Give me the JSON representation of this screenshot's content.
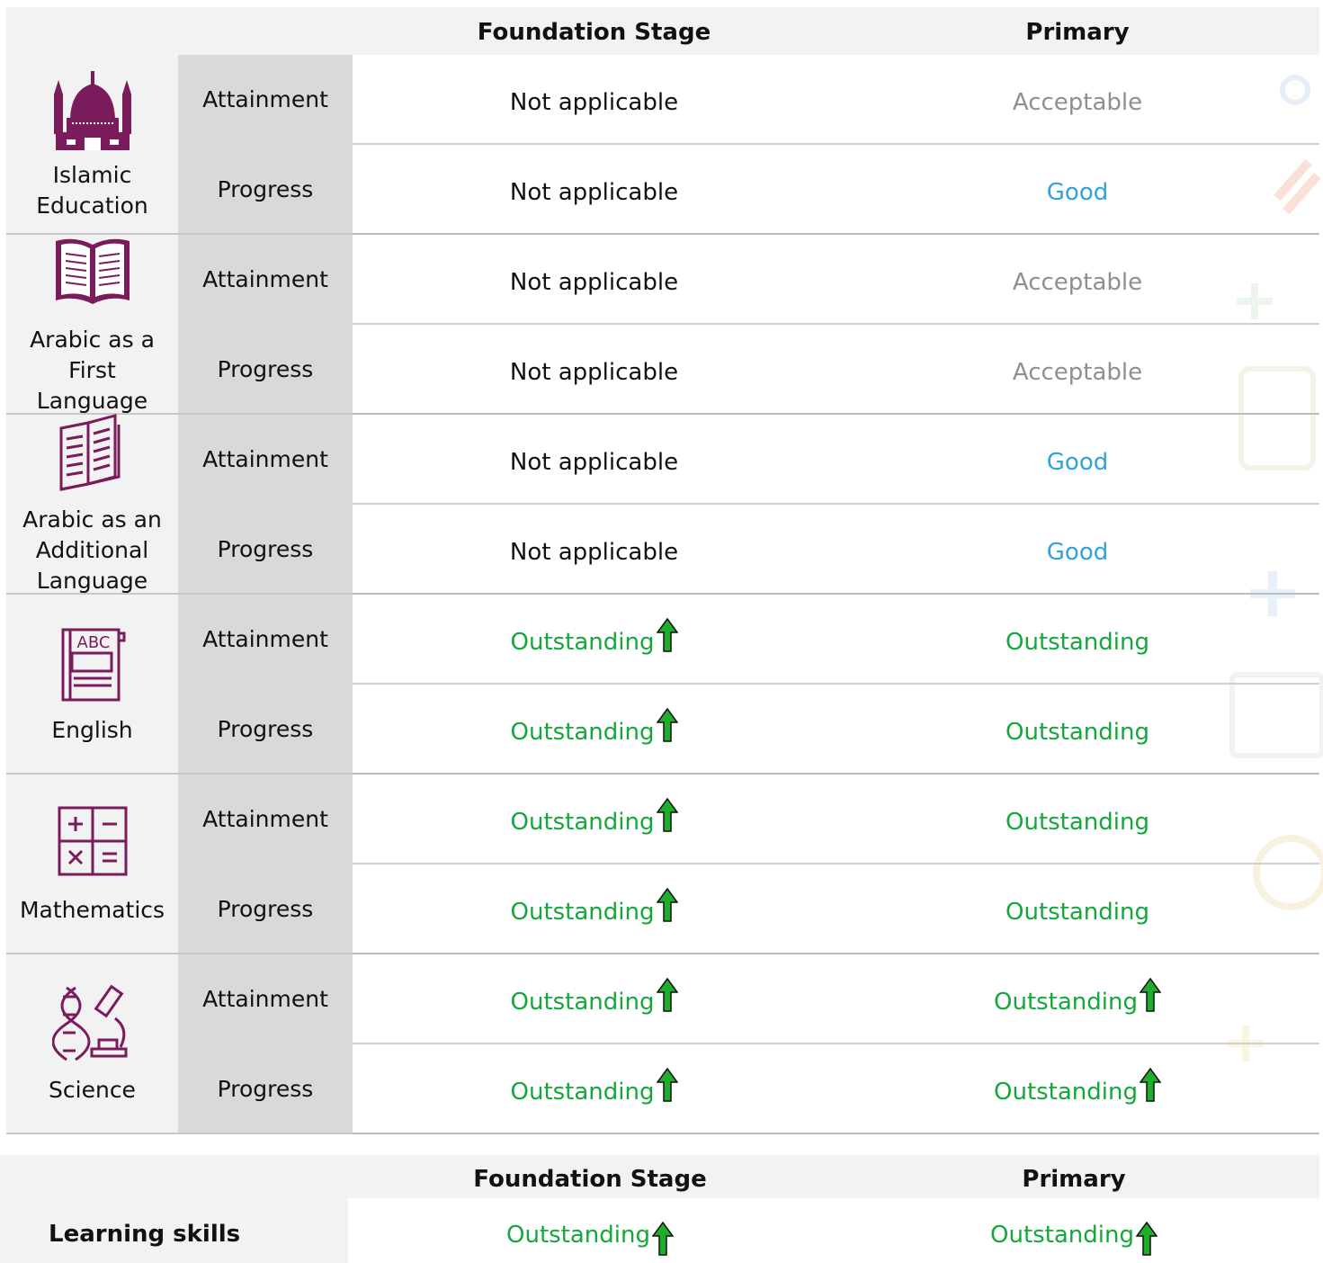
{
  "header": {
    "foundation_label": "Foundation Stage",
    "primary_label": "Primary"
  },
  "colors": {
    "icon_purple": "#7a1c5c",
    "not_applicable": "#111111",
    "acceptable": "#8f8f8f",
    "good": "#2ea3dc",
    "outstanding": "#14a83b",
    "arrow_green": "#1fae2c"
  },
  "subjects": [
    {
      "name": "Islamic\nEducation",
      "icon": "mosque-icon",
      "rows": [
        {
          "type": "Attainment",
          "foundation": "Not applicable",
          "foundation_status": "na",
          "foundation_arrow": false,
          "primary": "Acceptable",
          "primary_status": "acceptable",
          "primary_arrow": false
        },
        {
          "type": "Progress",
          "foundation": "Not applicable",
          "foundation_status": "na",
          "foundation_arrow": false,
          "primary": "Good",
          "primary_status": "good",
          "primary_arrow": false
        }
      ]
    },
    {
      "name": "Arabic as a\nFirst\nLanguage",
      "icon": "open-book-icon",
      "rows": [
        {
          "type": "Attainment",
          "foundation": "Not applicable",
          "foundation_status": "na",
          "foundation_arrow": false,
          "primary": "Acceptable",
          "primary_status": "acceptable",
          "primary_arrow": false
        },
        {
          "type": "Progress",
          "foundation": "Not applicable",
          "foundation_status": "na",
          "foundation_arrow": false,
          "primary": "Acceptable",
          "primary_status": "acceptable",
          "primary_arrow": false
        }
      ]
    },
    {
      "name": "Arabic as an\nAdditional\nLanguage",
      "icon": "book-outline-icon",
      "rows": [
        {
          "type": "Attainment",
          "foundation": "Not applicable",
          "foundation_status": "na",
          "foundation_arrow": false,
          "primary": "Good",
          "primary_status": "good",
          "primary_arrow": false
        },
        {
          "type": "Progress",
          "foundation": "Not applicable",
          "foundation_status": "na",
          "foundation_arrow": false,
          "primary": "Good",
          "primary_status": "good",
          "primary_arrow": false
        }
      ]
    },
    {
      "name": "English",
      "icon": "abc-book-icon",
      "rows": [
        {
          "type": "Attainment",
          "foundation": "Outstanding",
          "foundation_status": "outstanding",
          "foundation_arrow": true,
          "primary": "Outstanding",
          "primary_status": "outstanding",
          "primary_arrow": false
        },
        {
          "type": "Progress",
          "foundation": "Outstanding",
          "foundation_status": "outstanding",
          "foundation_arrow": true,
          "primary": "Outstanding",
          "primary_status": "outstanding",
          "primary_arrow": false
        }
      ]
    },
    {
      "name": "Mathematics",
      "icon": "calculator-icon",
      "rows": [
        {
          "type": "Attainment",
          "foundation": "Outstanding",
          "foundation_status": "outstanding",
          "foundation_arrow": true,
          "primary": "Outstanding",
          "primary_status": "outstanding",
          "primary_arrow": false
        },
        {
          "type": "Progress",
          "foundation": "Outstanding",
          "foundation_status": "outstanding",
          "foundation_arrow": true,
          "primary": "Outstanding",
          "primary_status": "outstanding",
          "primary_arrow": false
        }
      ]
    },
    {
      "name": "Science",
      "icon": "dna-microscope-icon",
      "rows": [
        {
          "type": "Attainment",
          "foundation": "Outstanding",
          "foundation_status": "outstanding",
          "foundation_arrow": true,
          "primary": "Outstanding",
          "primary_status": "outstanding",
          "primary_arrow": true
        },
        {
          "type": "Progress",
          "foundation": "Outstanding",
          "foundation_status": "outstanding",
          "foundation_arrow": true,
          "primary": "Outstanding",
          "primary_status": "outstanding",
          "primary_arrow": true
        }
      ]
    }
  ],
  "learning_skills": {
    "header_foundation": "Foundation Stage",
    "header_primary": "Primary",
    "label": "Learning skills",
    "foundation": "Outstanding",
    "foundation_status": "outstanding",
    "foundation_arrow": true,
    "primary": "Outstanding",
    "primary_status": "outstanding",
    "primary_arrow": true
  }
}
